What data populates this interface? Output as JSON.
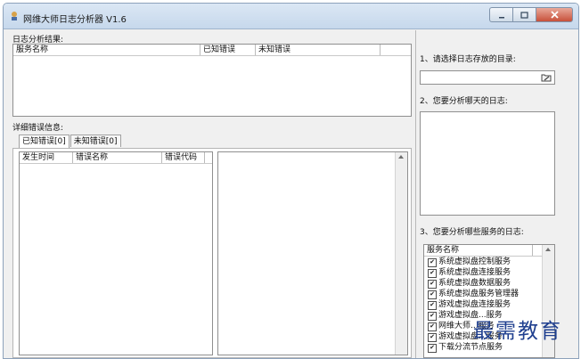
{
  "window": {
    "title": "网维大师日志分析器 V1.6"
  },
  "results": {
    "label": "日志分析结果:",
    "columns": [
      "服务名称",
      "已知错误",
      "未知错误"
    ]
  },
  "details": {
    "label": "详细错误信息:",
    "tabs": [
      "已知错误[0]",
      "未知错误[0]"
    ],
    "columns": [
      "发生时间",
      "错误名称",
      "错误代码"
    ]
  },
  "side": {
    "step1_label": "1、请选择日志存放的目录:",
    "dir_value": "",
    "step2_label": "2、您要分析哪天的日志:",
    "step3_label": "3、您要分析哪些服务的日志:",
    "services_header": "服务名称",
    "services": [
      "系统虚拟盘控制服务",
      "系统虚拟盘连接服务",
      "系统虚拟盘数据服务",
      "系统虚拟盘服务管理器",
      "游戏虚拟盘连接服务",
      "游戏虚拟盘...服务",
      "网维大师...服务",
      "游戏虚拟盘...服务",
      "下载分流节点服务"
    ]
  },
  "watermark": "最需教育"
}
